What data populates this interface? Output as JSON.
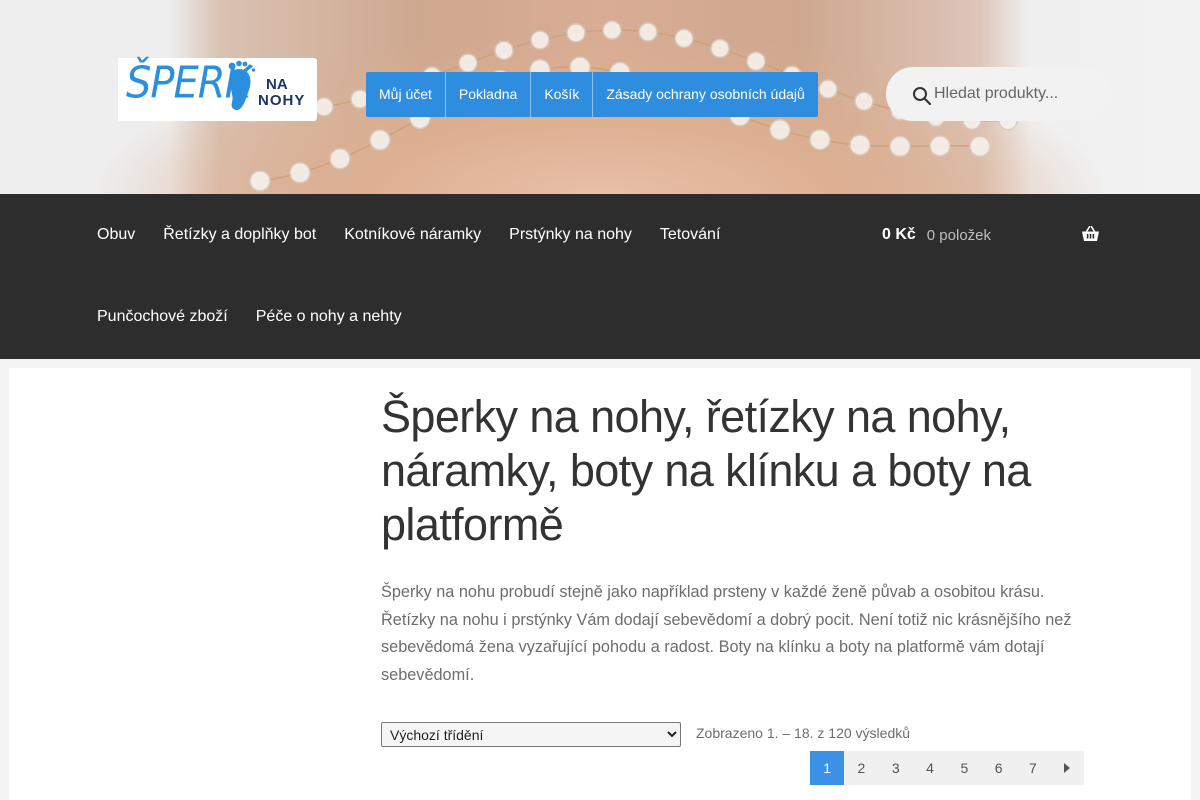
{
  "logo": {
    "word": "ŠPERK",
    "small_top": "NA",
    "small_bottom": "NOHY"
  },
  "top_menu": [
    "Můj účet",
    "Pokladna",
    "Košík",
    "Zásady ochrany osobních údajů"
  ],
  "search": {
    "placeholder": "Hledat produkty..."
  },
  "nav": {
    "row1": [
      "Obuv",
      "Řetízky a doplňky bot",
      "Kotníkové náramky",
      "Prstýnky na nohy",
      "Tetování"
    ],
    "row2": [
      "Punčochové zboží",
      "Péče o nohy a nehty"
    ]
  },
  "cart": {
    "amount": "0 Kč",
    "count": "0 položek"
  },
  "page": {
    "title": "Šperky na nohy, řetízky na nohy, náramky, boty na klínku a boty na platformě",
    "intro": "Šperky na nohu probudí stejně jako například prsteny v každé ženě půvab a osobitou krásu. Řetízky na nohu i prstýnky Vám dodají sebevědomí a dobrý pocit. Není totiž nic krásnějšího než sebevědomá žena vyzařující pohodu a radost. Boty na klínku a boty na platformě vám dotají sebevědomí."
  },
  "sort": {
    "selected": "Výchozí třídění"
  },
  "results": {
    "text": "Zobrazeno 1. – 18. z 120 výsledků"
  },
  "pagination": {
    "pages": [
      "1",
      "2",
      "3",
      "4",
      "5",
      "6",
      "7"
    ],
    "current": "1",
    "next_icon": "triangle-right-icon"
  },
  "colors": {
    "brand_blue": "#2f8de0",
    "navbar": "#2d2d2d",
    "logo_dark": "#1c3766"
  }
}
